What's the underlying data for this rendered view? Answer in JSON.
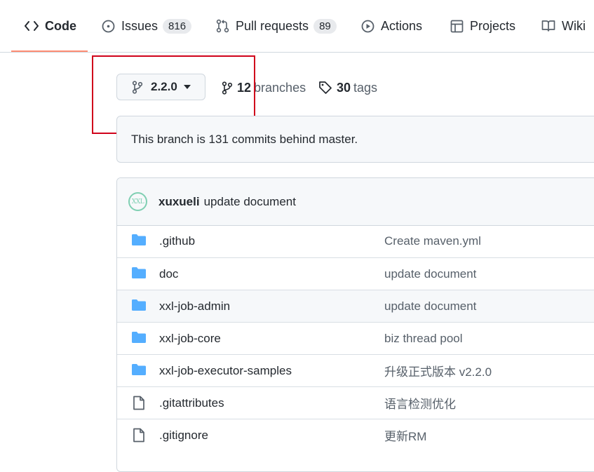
{
  "tabs": [
    {
      "label": "Code",
      "icon": "code-icon",
      "selected": true
    },
    {
      "label": "Issues",
      "icon": "issue-icon",
      "count": "816"
    },
    {
      "label": "Pull requests",
      "icon": "pull-request-icon",
      "count": "89"
    },
    {
      "label": "Actions",
      "icon": "play-icon"
    },
    {
      "label": "Projects",
      "icon": "project-table-icon"
    },
    {
      "label": "Wiki",
      "icon": "book-icon"
    }
  ],
  "branch": {
    "current": "2.2.0",
    "branches_count": "12",
    "branches_label": "branches",
    "tags_count": "30",
    "tags_label": "tags"
  },
  "banner": {
    "text": "This branch is 131 commits behind master."
  },
  "commit": {
    "avatar_text": "XXL",
    "author": "xuxueli",
    "message": "update document"
  },
  "files": [
    {
      "name": ".github",
      "type": "folder",
      "message": "Create maven.yml"
    },
    {
      "name": "doc",
      "type": "folder",
      "message": "update document"
    },
    {
      "name": "xxl-job-admin",
      "type": "folder",
      "message": "update document"
    },
    {
      "name": "xxl-job-core",
      "type": "folder",
      "message": "biz thread pool"
    },
    {
      "name": "xxl-job-executor-samples",
      "type": "folder",
      "message": "升级正式版本 v2.2.0"
    },
    {
      "name": ".gitattributes",
      "type": "file",
      "message": "语言检测优化"
    },
    {
      "name": ".gitignore",
      "type": "file",
      "message": "更新RM"
    }
  ],
  "colors": {
    "accent_underline": "#fd8c73",
    "folder": "#54aeff",
    "highlight_box": "#d0021b"
  }
}
